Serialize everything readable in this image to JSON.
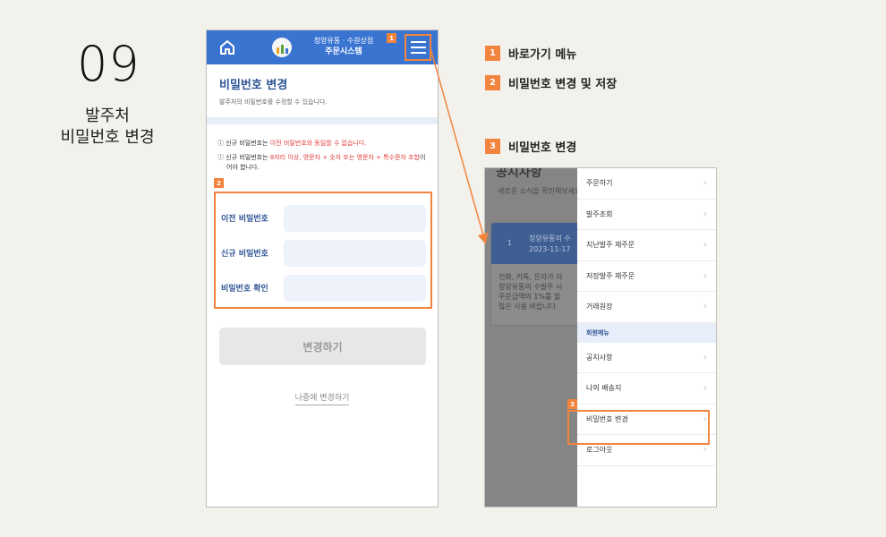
{
  "step": {
    "number": "09",
    "title_line1": "발주처",
    "title_line2": "비밀번호 변경"
  },
  "phone1": {
    "brand_line1": "청양유통 · 수원상점",
    "brand_line2": "주문시스템",
    "section_title": "비밀번호 변경",
    "section_sub": "발주처의 비밀번호를 수정할 수 있습니다.",
    "note1_prefix": "ⓘ 신규 비밀번호는 ",
    "note1_red": "이전 비밀번호와 동일할 수 없습니다.",
    "note2_prefix": "ⓘ 신규 비밀번호는 ",
    "note2_red": "8자리 이상, 영문자 + 숫자 또는 영문자 + 특수문자 조합",
    "note2_suffix": "이어야 합니다.",
    "fields": [
      {
        "label": "이전 비밀번호",
        "value": ""
      },
      {
        "label": "신규 비밀번호",
        "value": ""
      },
      {
        "label": "비밀번호 확인",
        "value": ""
      }
    ],
    "submit_label": "변경하기",
    "later_label": "나중에 변경하기",
    "badge1": "1",
    "badge2": "2"
  },
  "legend": [
    {
      "num": "1",
      "label": "바로가기 메뉴"
    },
    {
      "num": "2",
      "label": "비밀번호 변경 및 저장"
    },
    {
      "num": "3",
      "label": "비밀번호 변경"
    }
  ],
  "phone2": {
    "bg_title": "공지사항",
    "bg_sub": "새로운 소식을 확인해보세요",
    "bg_card_num": "1",
    "bg_card_line1": "청양유통의 수",
    "bg_card_date": "2023-11-17",
    "bg_card_body1": "전화, 카톡, 문자가 아",
    "bg_card_body2": "청양유통의 수발주 시",
    "bg_card_body3": "주문금액의 1%를 할",
    "bg_card_body4": "많은 사용 바랍니다",
    "menu_top": [
      "주문하기",
      "발주조회",
      "지난발주 재주문",
      "저장발주 재주문",
      "거래원장"
    ],
    "member_section": "회원메뉴",
    "menu_member": [
      "공지사항",
      "나의 배송지",
      "비밀번호 변경",
      "로그아웃"
    ],
    "chevron": "›",
    "badge3": "3"
  },
  "colors": {
    "accent": "#f2843e",
    "appbar": "#3a74d1",
    "title_blue": "#2f5596"
  }
}
